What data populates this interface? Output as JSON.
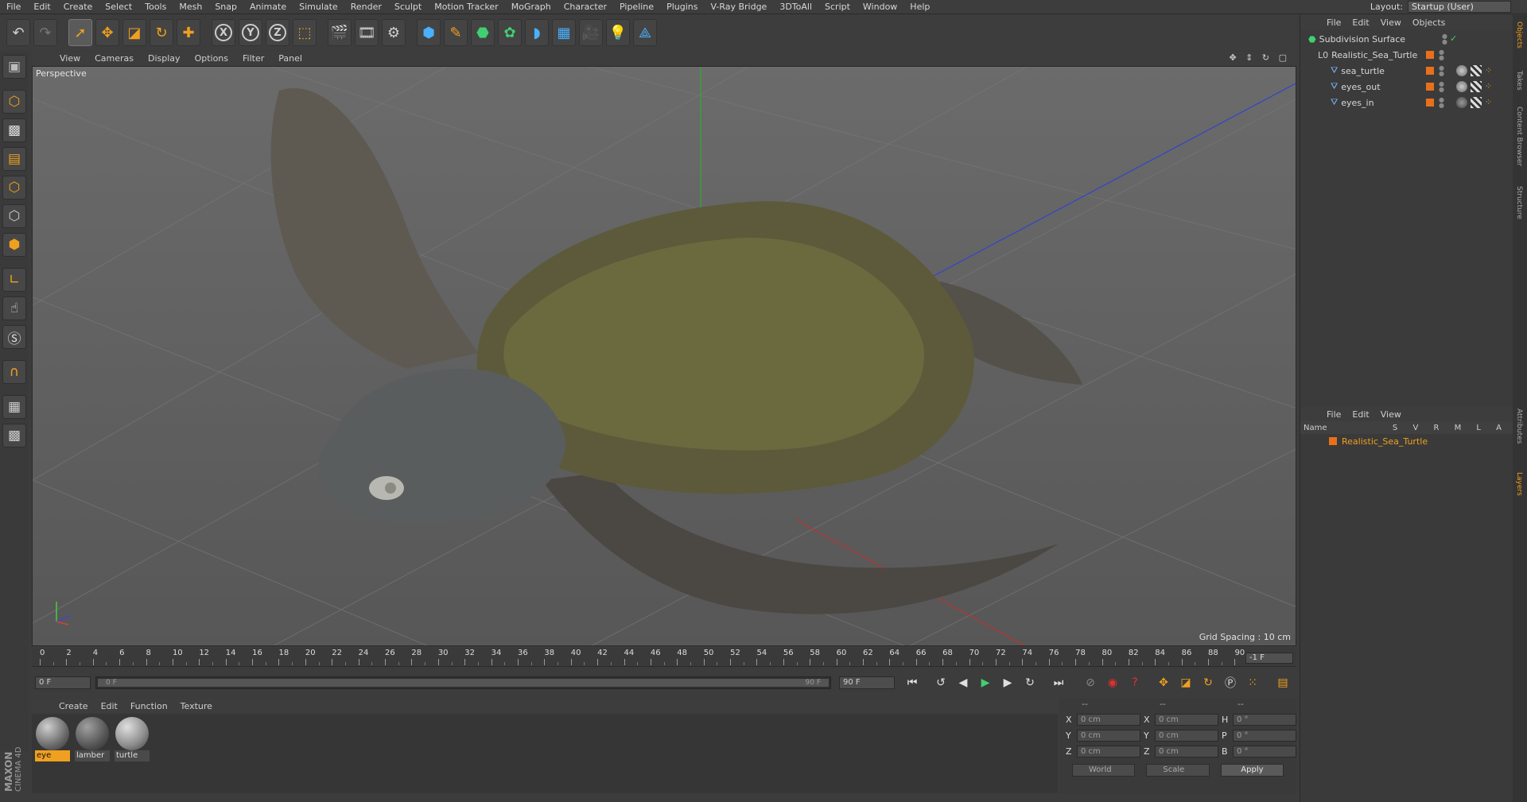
{
  "menu": [
    "File",
    "Edit",
    "Create",
    "Select",
    "Tools",
    "Mesh",
    "Snap",
    "Animate",
    "Simulate",
    "Render",
    "Sculpt",
    "Motion Tracker",
    "MoGraph",
    "Character",
    "Pipeline",
    "Plugins",
    "V-Ray Bridge",
    "3DToAll",
    "Script",
    "Window",
    "Help"
  ],
  "layout": {
    "label": "Layout:",
    "value": "Startup (User)"
  },
  "toolbar_axes": {
    "x": "X",
    "y": "Y",
    "z": "Z"
  },
  "viewport": {
    "menu": [
      "View",
      "Cameras",
      "Display",
      "Options",
      "Filter",
      "Panel"
    ],
    "label": "Perspective",
    "grid_spacing": "Grid Spacing : 10 cm"
  },
  "timeline": {
    "ticks": [
      "0",
      "2",
      "4",
      "6",
      "8",
      "10",
      "12",
      "14",
      "16",
      "18",
      "20",
      "22",
      "24",
      "26",
      "28",
      "30",
      "32",
      "34",
      "36",
      "38",
      "40",
      "42",
      "44",
      "46",
      "48",
      "50",
      "52",
      "54",
      "56",
      "58",
      "60",
      "62",
      "64",
      "66",
      "68",
      "70",
      "72",
      "74",
      "76",
      "78",
      "80",
      "82",
      "84",
      "86",
      "88",
      "90"
    ],
    "current_frame": "-1 F",
    "start_field": "0 F",
    "range_start": "0 F",
    "range_end": "90 F",
    "end_field": "90 F"
  },
  "material_manager": {
    "menu": [
      "Create",
      "Edit",
      "Function",
      "Texture"
    ],
    "materials": [
      {
        "name": "eye",
        "selected": true
      },
      {
        "name": "lamber",
        "selected": false
      },
      {
        "name": "turtle",
        "selected": false
      }
    ]
  },
  "coordinates": {
    "headers": [
      "--",
      "--",
      "--"
    ],
    "rows": [
      {
        "a": "X",
        "av": "0 cm",
        "b": "X",
        "bv": "0 cm",
        "c": "H",
        "cv": "0 °"
      },
      {
        "a": "Y",
        "av": "0 cm",
        "b": "Y",
        "bv": "0 cm",
        "c": "P",
        "cv": "0 °"
      },
      {
        "a": "Z",
        "av": "0 cm",
        "b": "Z",
        "bv": "0 cm",
        "c": "B",
        "cv": "0 °"
      }
    ],
    "mode1": "World",
    "mode2": "Scale",
    "apply": "Apply"
  },
  "objects_panel": {
    "menu": [
      "File",
      "Edit",
      "View",
      "Objects"
    ],
    "items": [
      {
        "name": "Subdivision Surface",
        "level": 0
      },
      {
        "name": "Realistic_Sea_Turtle",
        "level": 1
      },
      {
        "name": "sea_turtle",
        "level": 2
      },
      {
        "name": "eyes_out",
        "level": 2
      },
      {
        "name": "eyes_in",
        "level": 2
      }
    ]
  },
  "layers_panel": {
    "menu": [
      "File",
      "Edit",
      "View"
    ],
    "name_header": "Name",
    "cols": "S V R M L A",
    "layer": "Realistic_Sea_Turtle"
  },
  "side_tabs": [
    "Objects",
    "Takes",
    "Content Browser",
    "Structure",
    "Attributes",
    "Layers"
  ],
  "brand": [
    "MAXON",
    "CINEMA 4D"
  ],
  "colors": {
    "accent": "#f0a020",
    "tag": "#e8701a",
    "viewport_bg": "#666666"
  }
}
